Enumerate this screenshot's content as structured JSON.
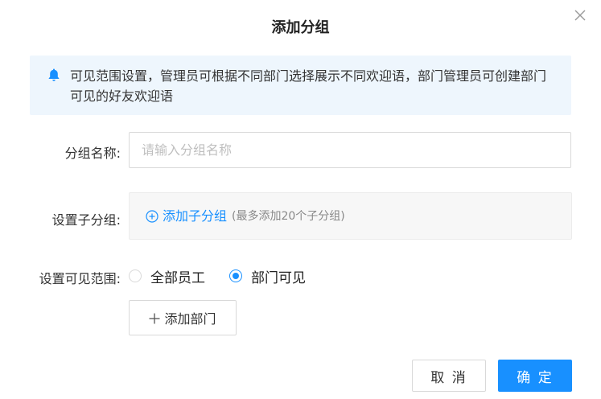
{
  "dialog": {
    "title": "添加分组",
    "close_icon": "close-icon"
  },
  "notice": {
    "icon": "bell-icon",
    "text": "可见范围设置，管理员可根据不同部门选择展示不同欢迎语，部门管理员可创建部门可见的好友欢迎语"
  },
  "form": {
    "group_name": {
      "label": "分组名称:",
      "placeholder": "请输入分组名称",
      "value": ""
    },
    "subgroup": {
      "label": "设置子分组:",
      "add_label": "添加子分组",
      "hint": "(最多添加20个子分组)"
    },
    "visibility": {
      "label": "设置可见范围:",
      "options": [
        {
          "label": "全部员工",
          "selected": false
        },
        {
          "label": "部门可见",
          "selected": true
        }
      ],
      "add_dept_label": "添加部门"
    }
  },
  "footer": {
    "cancel_label": "取 消",
    "confirm_label": "确 定"
  },
  "colors": {
    "primary": "#1890ff",
    "notice_bg": "#eef6fd",
    "border": "#d9d9d9"
  }
}
